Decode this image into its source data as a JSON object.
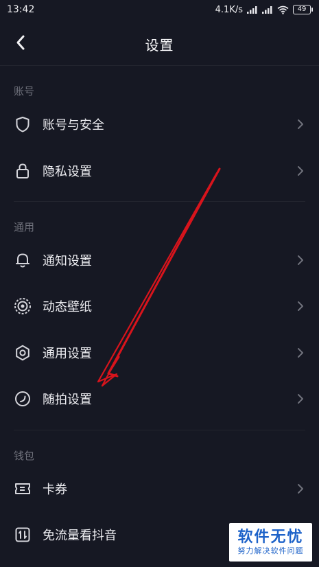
{
  "status_bar": {
    "time": "13:42",
    "network_speed": "4.1K/s",
    "battery_level": "49"
  },
  "nav": {
    "title": "设置",
    "back_icon": "chevron-left-icon"
  },
  "sections": [
    {
      "header": "账号",
      "items": [
        {
          "label": "账号与安全",
          "icon": "shield-icon"
        },
        {
          "label": "隐私设置",
          "icon": "lock-icon"
        }
      ]
    },
    {
      "header": "通用",
      "items": [
        {
          "label": "通知设置",
          "icon": "bell-icon"
        },
        {
          "label": "动态壁纸",
          "icon": "live-wallpaper-icon"
        },
        {
          "label": "通用设置",
          "icon": "gear-icon"
        },
        {
          "label": "随拍设置",
          "icon": "snapshot-icon"
        }
      ]
    },
    {
      "header": "钱包",
      "items": [
        {
          "label": "卡券",
          "icon": "ticket-icon"
        },
        {
          "label": "免流量看抖音",
          "icon": "data-free-icon"
        }
      ]
    }
  ],
  "watermark": {
    "title": "软件无忧",
    "subtitle": "努力解决软件问题"
  },
  "colors": {
    "background": "#161823",
    "annotation_arrow": "#d8141c",
    "watermark_text": "#1e63c9"
  }
}
